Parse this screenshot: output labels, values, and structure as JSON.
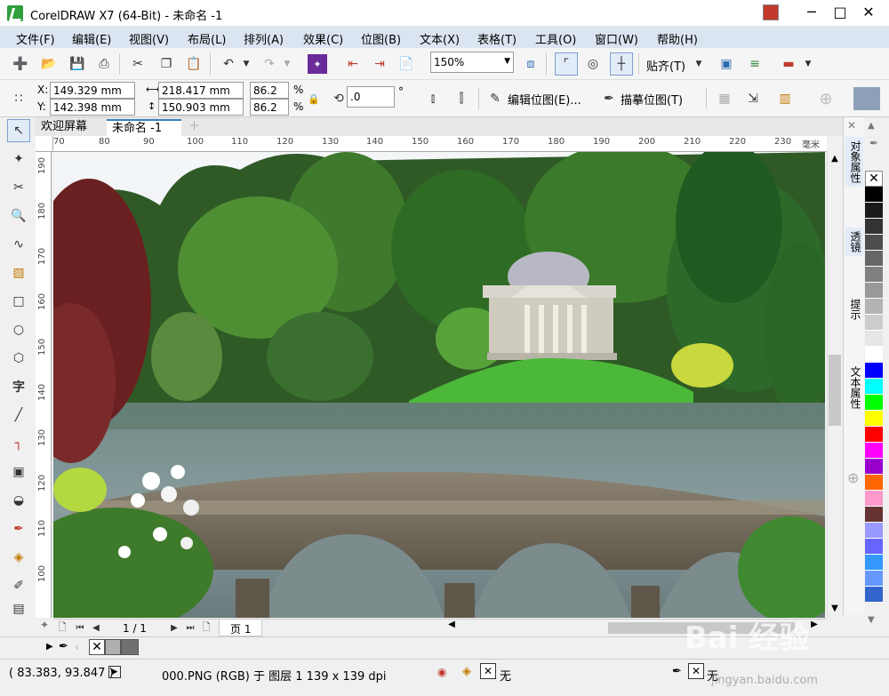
{
  "window": {
    "title": "CorelDRAW X7 (64-Bit) - 未命名 -1"
  },
  "menu": [
    "文件(F)",
    "编辑(E)",
    "视图(V)",
    "布局(L)",
    "排列(A)",
    "效果(C)",
    "位图(B)",
    "文本(X)",
    "表格(T)",
    "工具(O)",
    "窗口(W)",
    "帮助(H)"
  ],
  "toolbar": {
    "zoom": "150%",
    "snap_label": "贴齐(T)"
  },
  "propbar": {
    "x_label": "X:",
    "x_value": "149.329 mm",
    "y_label": "Y:",
    "y_value": "142.398 mm",
    "w_value": "218.417 mm",
    "h_value": "150.903 mm",
    "scale_w": "86.2",
    "scale_h": "86.2",
    "pct": "%",
    "rotation": ".0",
    "degree": "°",
    "edit_bitmap": "编辑位图(E)...",
    "trace_bitmap": "描摹位图(T)"
  },
  "tabs": [
    "欢迎屏幕",
    "未命名 -1"
  ],
  "ruler": {
    "h_ticks": [
      "70",
      "80",
      "90",
      "100",
      "110",
      "120",
      "130",
      "140",
      "150",
      "160",
      "170",
      "180",
      "190",
      "200",
      "210",
      "220",
      "230"
    ],
    "unit": "毫米",
    "v_ticks": [
      "190",
      "180",
      "170",
      "160",
      "150",
      "140",
      "130",
      "120",
      "110",
      "100"
    ]
  },
  "docker": [
    "对象属性",
    "透镜",
    "提示",
    "文本属性"
  ],
  "pagenav": {
    "page_count": "1 / 1",
    "page_tab": "页 1"
  },
  "status": {
    "coords": "( 83.383, 93.847 )",
    "object_info": "000.PNG (RGB) 于 图层 1 139 x 139 dpi",
    "fill_none": "无",
    "outline_none": "无"
  },
  "watermark": "Bai 经验",
  "watermark_sub": "jingyan.baidu.com",
  "palette_colors": [
    "#000000",
    "#1a1a1a",
    "#333333",
    "#4d4d4d",
    "#666666",
    "#808080",
    "#999999",
    "#b3b3b3",
    "#cccccc",
    "#e6e6e6",
    "#ffffff",
    "#0000ff",
    "#00ffff",
    "#00ff00",
    "#ffff00",
    "#ff0000",
    "#ff00ff",
    "#9900cc",
    "#ff6600",
    "#ff99cc",
    "#663333",
    "#9999ff",
    "#6666ff",
    "#3399ff",
    "#6699ff",
    "#3366cc"
  ]
}
